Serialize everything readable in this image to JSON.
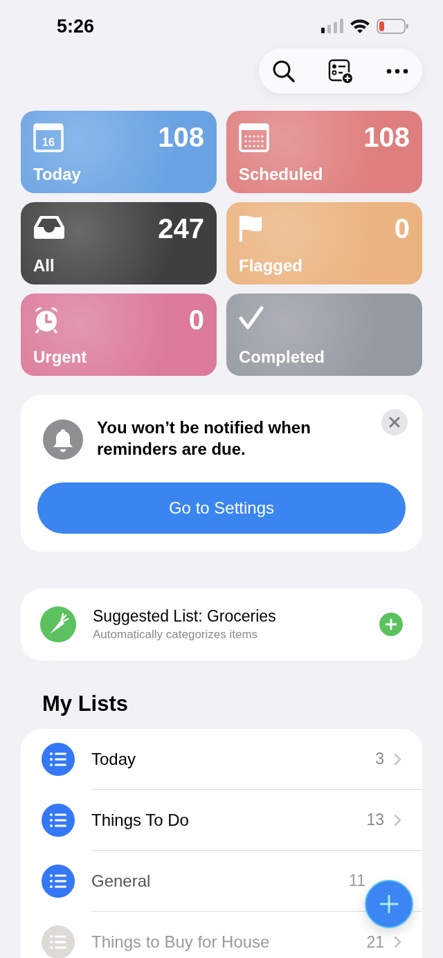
{
  "status_bar": {
    "time": "5:26"
  },
  "tiles": [
    {
      "kind": "today",
      "icon_text": "16",
      "count": "108",
      "label": "Today",
      "color": "#6aa3e4"
    },
    {
      "kind": "scheduled",
      "count": "108",
      "label": "Scheduled",
      "color": "#df7e7e"
    },
    {
      "kind": "all",
      "count": "247",
      "label": "All",
      "color": "#3f3f3f"
    },
    {
      "kind": "flagged",
      "count": "0",
      "label": "Flagged",
      "color": "#eab37f"
    },
    {
      "kind": "urgent",
      "count": "0",
      "label": "Urgent",
      "color": "#db7a9a"
    },
    {
      "kind": "completed",
      "label": "Completed",
      "color": "#959aa2"
    }
  ],
  "notice": {
    "message": "You won’t be notified when reminders are due.",
    "button": "Go to Settings"
  },
  "suggestion": {
    "title": "Suggested List: Groceries",
    "subtitle": "Automatically categorizes items"
  },
  "my_lists": {
    "heading": "My Lists",
    "items": [
      {
        "name": "Today",
        "count": "3",
        "color": "#3478f6"
      },
      {
        "name": "Things To Do",
        "count": "13",
        "color": "#3478f6"
      },
      {
        "name": "General",
        "count": "11",
        "color": "#3478f6"
      },
      {
        "name": "Things to Buy for House",
        "count": "21",
        "color": "#dedbd6"
      }
    ]
  }
}
